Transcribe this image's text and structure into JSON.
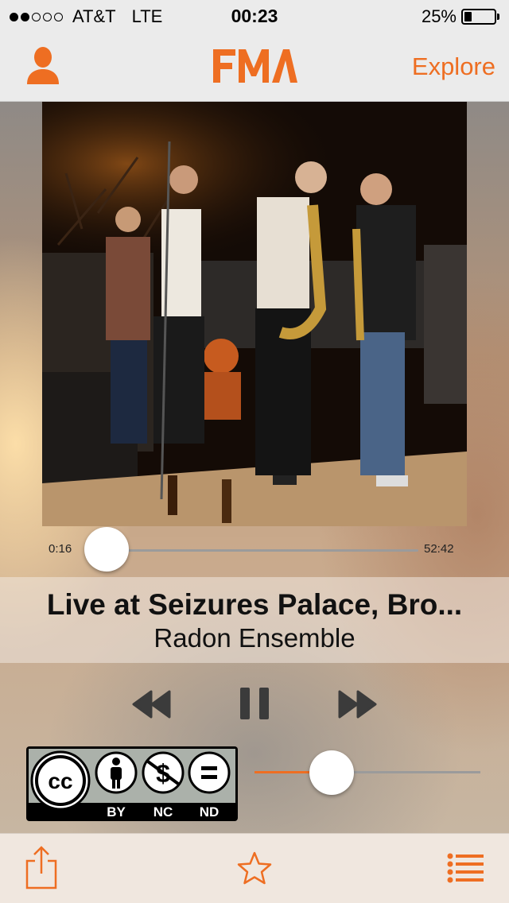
{
  "status_bar": {
    "signal_bars_filled": 2,
    "signal_bars_total": 5,
    "carrier": "AT&T",
    "network": "LTE",
    "time": "00:23",
    "battery_percent": "25%",
    "battery_level": 0.25
  },
  "nav": {
    "profile_icon": "person-icon",
    "logo_text": "FMA",
    "explore_label": "Explore"
  },
  "player": {
    "artwork_icon": "album-artwork-band-photo",
    "elapsed": "0:16",
    "duration": "52:42",
    "progress": 0.005,
    "title": "Live at Seizures Palace, Bro...",
    "artist": "Radon Ensemble",
    "volume": 0.35
  },
  "controls": {
    "rewind_icon": "rewind-icon",
    "pause_icon": "pause-icon",
    "forward_icon": "fast-forward-icon"
  },
  "license": {
    "cc_label": "cc",
    "by_label": "BY",
    "nc_label": "NC",
    "nd_label": "ND"
  },
  "tabbar": {
    "share_icon": "share-icon",
    "favorite_icon": "star-icon",
    "queue_icon": "list-icon"
  },
  "colors": {
    "accent": "#ee6e22",
    "bar_bg": "#ebebeb"
  }
}
